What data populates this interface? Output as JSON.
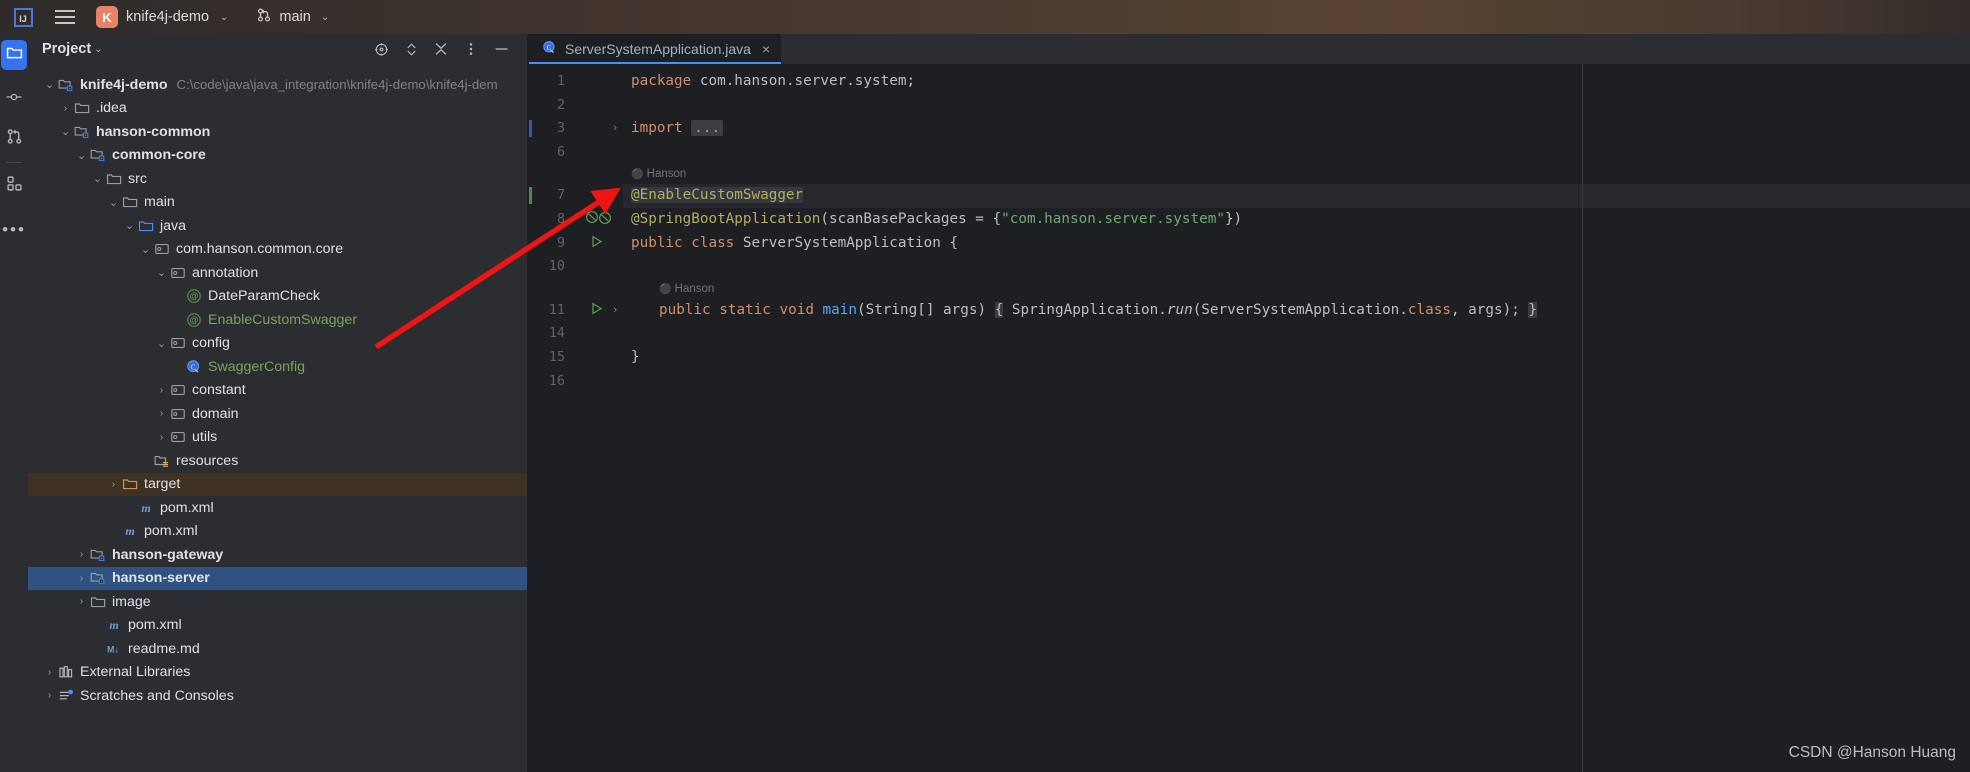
{
  "topbar": {
    "ide_logo": "intellij-idea-logo",
    "menu_icon": "hamburger-menu-icon",
    "project_initial": "K",
    "project_name": "knife4j-demo",
    "project_chevron": "⌄",
    "branch_icon": "git-branch-icon",
    "branch_name": "main",
    "branch_chevron": "⌄"
  },
  "activity_bar": {
    "items": [
      {
        "name": "project-tool-window",
        "icon": "folder-icon",
        "selected": true
      },
      {
        "name": "commit-tool-window",
        "icon": "commit-node-icon",
        "selected": false
      },
      {
        "name": "pull-requests-tool-window",
        "icon": "pull-request-icon",
        "selected": false
      },
      {
        "name": "services-tool-window",
        "icon": "squares-icon",
        "selected": false
      },
      {
        "name": "more-tool-windows",
        "icon": "ellipsis-icon",
        "selected": false
      }
    ]
  },
  "project_panel": {
    "title": "Project",
    "title_chevron": "⌄",
    "toolbar": [
      {
        "name": "select-opened-file-button",
        "icon": "crosshair-icon"
      },
      {
        "name": "expand-collapse-button",
        "icon": "chevron-updown-icon"
      },
      {
        "name": "collapse-all-button",
        "icon": "collapse-all-icon"
      },
      {
        "name": "options-button",
        "icon": "vertical-dots-icon"
      },
      {
        "name": "hide-button",
        "icon": "minus-icon"
      }
    ],
    "tree": [
      {
        "depth": 0,
        "arrow": "⌄",
        "icon": "module-folder-icon",
        "label": "knife4j-demo",
        "bold": true,
        "suffix": "C:\\code\\java\\java_integration\\knife4j-demo\\knife4j-dem"
      },
      {
        "depth": 1,
        "arrow": "›",
        "icon": "folder-icon",
        "label": ".idea"
      },
      {
        "depth": 1,
        "arrow": "⌄",
        "icon": "module-folder-icon",
        "label": "hanson-common",
        "bold": true
      },
      {
        "depth": 2,
        "arrow": "⌄",
        "icon": "module-folder-icon",
        "label": "common-core",
        "bold": true
      },
      {
        "depth": 3,
        "arrow": "⌄",
        "icon": "folder-icon",
        "label": "src"
      },
      {
        "depth": 4,
        "arrow": "⌄",
        "icon": "folder-icon",
        "label": "main"
      },
      {
        "depth": 5,
        "arrow": "⌄",
        "icon": "source-folder-icon",
        "label": "java"
      },
      {
        "depth": 6,
        "arrow": "⌄",
        "icon": "package-icon",
        "label": "com.hanson.common.core"
      },
      {
        "depth": 7,
        "arrow": "⌄",
        "icon": "package-icon",
        "label": "annotation"
      },
      {
        "depth": 8,
        "arrow": "",
        "icon": "annotation-icon",
        "label": "DateParamCheck"
      },
      {
        "depth": 8,
        "arrow": "",
        "icon": "annotation-icon",
        "label": "EnableCustomSwagger",
        "greenText": true
      },
      {
        "depth": 7,
        "arrow": "⌄",
        "icon": "package-icon",
        "label": "config"
      },
      {
        "depth": 8,
        "arrow": "",
        "icon": "class-icon",
        "label": "SwaggerConfig",
        "greenText": true
      },
      {
        "depth": 7,
        "arrow": "›",
        "icon": "package-icon",
        "label": "constant"
      },
      {
        "depth": 7,
        "arrow": "›",
        "icon": "package-icon",
        "label": "domain"
      },
      {
        "depth": 7,
        "arrow": "›",
        "icon": "package-icon",
        "label": "utils"
      },
      {
        "depth": 6,
        "arrow": "",
        "icon": "resources-folder-icon",
        "label": "resources"
      },
      {
        "depth": 4,
        "arrow": "›",
        "icon": "excluded-folder-icon",
        "label": "target",
        "state": "target"
      },
      {
        "depth": 5,
        "arrow": "",
        "icon": "maven-file-icon",
        "label": "pom.xml"
      },
      {
        "depth": 4,
        "arrow": "",
        "icon": "maven-file-icon",
        "label": "pom.xml"
      },
      {
        "depth": 2,
        "arrow": "›",
        "icon": "module-folder-icon",
        "label": "hanson-gateway",
        "bold": true
      },
      {
        "depth": 2,
        "arrow": "›",
        "icon": "module-folder-icon",
        "label": "hanson-server",
        "bold": true,
        "state": "selected"
      },
      {
        "depth": 2,
        "arrow": "›",
        "icon": "folder-icon",
        "label": "image"
      },
      {
        "depth": 3,
        "arrow": "",
        "icon": "maven-file-icon",
        "label": "pom.xml"
      },
      {
        "depth": 3,
        "arrow": "",
        "icon": "markdown-file-icon",
        "label": "readme.md"
      },
      {
        "depth": 0,
        "arrow": "›",
        "icon": "library-icon",
        "label": "External Libraries"
      },
      {
        "depth": 0,
        "arrow": "›",
        "icon": "scratches-icon",
        "label": "Scratches and Consoles"
      }
    ]
  },
  "editor": {
    "tab": {
      "icon": "java-class-icon",
      "label": "ServerSystemApplication.java",
      "close": "×"
    },
    "lines": [
      {
        "num": "1",
        "marker": "",
        "gutter_icon": "",
        "fold": "",
        "hint": "",
        "highlight": false,
        "tokens": [
          {
            "t": "package ",
            "c": "kw"
          },
          {
            "t": "com.hanson.server.system;",
            "c": "plain"
          }
        ]
      },
      {
        "num": "2",
        "marker": "",
        "gutter_icon": "",
        "fold": "",
        "hint": "",
        "highlight": false,
        "tokens": []
      },
      {
        "num": "3",
        "marker": "blue",
        "gutter_icon": "",
        "fold": "›",
        "hint": "",
        "highlight": false,
        "tokens": [
          {
            "t": "import ",
            "c": "kw"
          },
          {
            "t": "...",
            "c": "folddots"
          }
        ]
      },
      {
        "num": "6",
        "marker": "",
        "gutter_icon": "",
        "fold": "",
        "hint": "",
        "highlight": false,
        "tokens": []
      },
      {
        "num": "",
        "marker": "",
        "gutter_icon": "",
        "fold": "",
        "hint": "Hanson",
        "highlight": false,
        "tokens": []
      },
      {
        "num": "7",
        "marker": "green",
        "gutter_icon": "",
        "fold": "",
        "hint": "",
        "highlight": true,
        "tokens": [
          {
            "t": "@EnableCustomSwagger",
            "c": "ann sel-hl"
          }
        ]
      },
      {
        "num": "8",
        "marker": "",
        "gutter_icon": "bean-icon",
        "fold": "",
        "hint": "",
        "highlight": false,
        "tokens": [
          {
            "t": "@SpringBootApplication",
            "c": "ann"
          },
          {
            "t": "(scanBasePackages = {",
            "c": "plain"
          },
          {
            "t": "\"com.hanson.server.system\"",
            "c": "str"
          },
          {
            "t": "})",
            "c": "plain"
          }
        ]
      },
      {
        "num": "9",
        "marker": "",
        "gutter_icon": "run-icon",
        "fold": "",
        "hint": "",
        "highlight": false,
        "tokens": [
          {
            "t": "public class ",
            "c": "kw"
          },
          {
            "t": "ServerSystemApplication {",
            "c": "plain"
          }
        ]
      },
      {
        "num": "10",
        "marker": "",
        "gutter_icon": "",
        "fold": "",
        "hint": "",
        "highlight": false,
        "tokens": []
      },
      {
        "num": "",
        "marker": "",
        "gutter_icon": "",
        "fold": "",
        "hint": "Hanson",
        "hint_indent": 28,
        "highlight": false,
        "tokens": []
      },
      {
        "num": "11",
        "marker": "",
        "gutter_icon": "run-icon",
        "fold": "›",
        "hint": "",
        "highlight": false,
        "indent": 28,
        "tokens": [
          {
            "t": "public static void ",
            "c": "kw"
          },
          {
            "t": "main",
            "c": "meth"
          },
          {
            "t": "(String[] args) ",
            "c": "plain"
          },
          {
            "t": "{",
            "c": "plain brace-hl"
          },
          {
            "t": " SpringApplication.",
            "c": "plain"
          },
          {
            "t": "run",
            "c": "plain italic"
          },
          {
            "t": "(ServerSystemApplication.",
            "c": "plain"
          },
          {
            "t": "class",
            "c": "kw"
          },
          {
            "t": ", args); ",
            "c": "plain"
          },
          {
            "t": "}",
            "c": "plain brace-hl"
          }
        ]
      },
      {
        "num": "14",
        "marker": "",
        "gutter_icon": "",
        "fold": "",
        "hint": "",
        "highlight": false,
        "tokens": []
      },
      {
        "num": "15",
        "marker": "",
        "gutter_icon": "",
        "fold": "",
        "hint": "",
        "highlight": false,
        "tokens": [
          {
            "t": "}",
            "c": "plain"
          }
        ]
      },
      {
        "num": "16",
        "marker": "",
        "gutter_icon": "",
        "fold": "",
        "hint": "",
        "highlight": false,
        "tokens": []
      }
    ]
  },
  "annotation": {
    "arrow_color": "#f01414",
    "arrow_name": "red-pointer-arrow"
  },
  "watermark": {
    "text": "CSDN @Hanson Huang"
  },
  "colors": {
    "accent": "#3573f0",
    "selection": "#2f5282",
    "editor_bg": "#1e1f22",
    "panel_bg": "#2b2d30",
    "annotation_token": "#b3ae60",
    "string_token": "#6aab73",
    "keyword_token": "#cf8e6d"
  }
}
